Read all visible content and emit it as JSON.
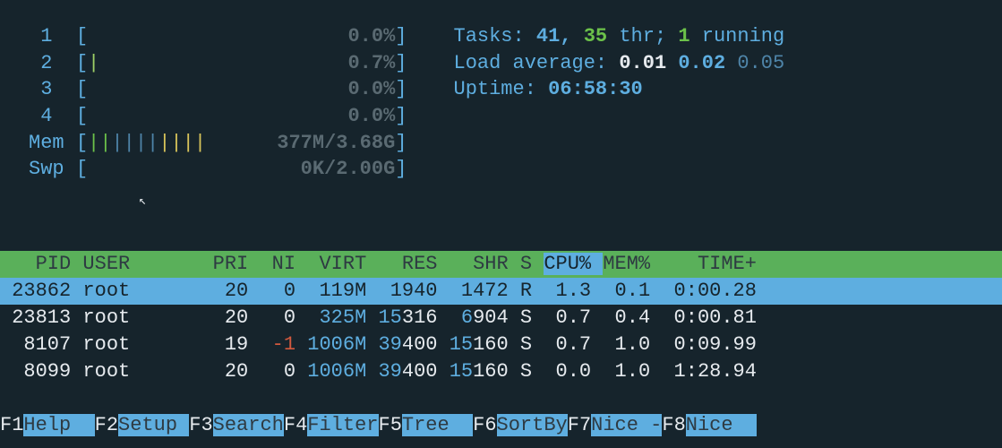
{
  "cpu": [
    {
      "n": "1",
      "ticks": "",
      "pct": "0.0%"
    },
    {
      "n": "2",
      "ticks": "|",
      "pct": "0.7%"
    },
    {
      "n": "3",
      "ticks": "",
      "pct": "0.0%"
    },
    {
      "n": "4",
      "ticks": "",
      "pct": "0.0%"
    }
  ],
  "mem": {
    "label": "Mem",
    "ticks_g": "||",
    "ticks_b": "||||",
    "ticks_y": "||||",
    "val": "377M/3.68G"
  },
  "swp": {
    "label": "Swp",
    "val": "0K/2.00G"
  },
  "stats": {
    "tasks_label": "Tasks: ",
    "tasks_total": "41",
    "tasks_sep": ", ",
    "tasks_thr": "35",
    "tasks_thr_label": " thr; ",
    "tasks_run": "1",
    "tasks_run_label": " running",
    "load_label": "Load average: ",
    "load1": "0.01",
    "load2": "0.02",
    "load3": "0.05",
    "uptime_label": "Uptime: ",
    "uptime": "06:58:30"
  },
  "columns": {
    "pid": "PID",
    "user": "USER",
    "pri": "PRI",
    "ni": "NI",
    "virt": "VIRT",
    "res": "RES",
    "shr": "SHR",
    "s": "S",
    "cpu": "CPU%",
    "mem": "MEM%",
    "time": "TIME+"
  },
  "rows": [
    {
      "pid": "23862",
      "user": "root",
      "pri": "20",
      "ni": "0",
      "virt": "119M",
      "res_p": "",
      "res_s": "1940",
      "shr_p": "",
      "shr_s": "1472",
      "s": "R",
      "cpu": "1.3",
      "mem": "0.1",
      "time": "0:00.28",
      "selected": true
    },
    {
      "pid": "23813",
      "user": "root",
      "pri": "20",
      "ni": "0",
      "virt": "325M",
      "res_p": "15",
      "res_s": "316",
      "shr_p": "6",
      "shr_s": "904",
      "s": "S",
      "cpu": "0.7",
      "mem": "0.4",
      "time": "0:00.81",
      "selected": false
    },
    {
      "pid": "8107",
      "user": "root",
      "pri": "19",
      "ni": "-1",
      "virt": "1006M",
      "res_p": "39",
      "res_s": "400",
      "shr_p": "15",
      "shr_s": "160",
      "s": "S",
      "cpu": "0.7",
      "mem": "1.0",
      "time": "0:09.99",
      "selected": false
    },
    {
      "pid": "8099",
      "user": "root",
      "pri": "20",
      "ni": "0",
      "virt": "1006M",
      "res_p": "39",
      "res_s": "400",
      "shr_p": "15",
      "shr_s": "160",
      "s": "S",
      "cpu": "0.0",
      "mem": "1.0",
      "time": "1:28.94",
      "selected": false
    }
  ],
  "fkeys": [
    {
      "k": "F1",
      "l": "Help  "
    },
    {
      "k": "F2",
      "l": "Setup "
    },
    {
      "k": "F3",
      "l": "Search"
    },
    {
      "k": "F4",
      "l": "Filter"
    },
    {
      "k": "F5",
      "l": "Tree  "
    },
    {
      "k": "F6",
      "l": "SortBy"
    },
    {
      "k": "F7",
      "l": "Nice -"
    },
    {
      "k": "F8",
      "l": "Nice  "
    }
  ]
}
